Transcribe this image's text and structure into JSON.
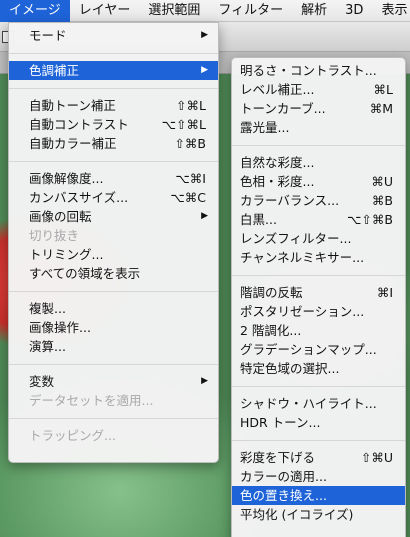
{
  "menubar": {
    "items": [
      "イメージ",
      "レイヤー",
      "選択範囲",
      "フィルター",
      "解析",
      "3D",
      "表示"
    ],
    "active_index": 0
  },
  "image_menu": {
    "groups": [
      [
        {
          "label": "モード",
          "submenu": true
        }
      ],
      [
        {
          "label": "色調補正",
          "submenu": true,
          "highlighted": true
        }
      ],
      [
        {
          "label": "自動トーン補正",
          "shortcut": "⇧⌘L"
        },
        {
          "label": "自動コントラスト",
          "shortcut": "⌥⇧⌘L"
        },
        {
          "label": "自動カラー補正",
          "shortcut": "⇧⌘B"
        }
      ],
      [
        {
          "label": "画像解像度...",
          "shortcut": "⌥⌘I"
        },
        {
          "label": "カンバスサイズ...",
          "shortcut": "⌥⌘C"
        },
        {
          "label": "画像の回転",
          "submenu": true
        },
        {
          "label": "切り抜き",
          "disabled": true
        },
        {
          "label": "トリミング..."
        },
        {
          "label": "すべての領域を表示"
        }
      ],
      [
        {
          "label": "複製..."
        },
        {
          "label": "画像操作..."
        },
        {
          "label": "演算..."
        }
      ],
      [
        {
          "label": "変数",
          "submenu": true
        },
        {
          "label": "データセットを適用...",
          "disabled": true
        }
      ],
      [
        {
          "label": "トラッピング...",
          "disabled": true
        }
      ]
    ]
  },
  "adjustments_menu": {
    "groups": [
      [
        {
          "label": "明るさ・コントラスト..."
        },
        {
          "label": "レベル補正...",
          "shortcut": "⌘L"
        },
        {
          "label": "トーンカーブ...",
          "shortcut": "⌘M"
        },
        {
          "label": "露光量..."
        }
      ],
      [
        {
          "label": "自然な彩度..."
        },
        {
          "label": "色相・彩度...",
          "shortcut": "⌘U"
        },
        {
          "label": "カラーバランス...",
          "shortcut": "⌘B"
        },
        {
          "label": "白黒...",
          "shortcut": "⌥⇧⌘B"
        },
        {
          "label": "レンズフィルター..."
        },
        {
          "label": "チャンネルミキサー..."
        }
      ],
      [
        {
          "label": "階調の反転",
          "shortcut": "⌘I"
        },
        {
          "label": "ポスタリゼーション..."
        },
        {
          "label": "2 階調化..."
        },
        {
          "label": "グラデーションマップ..."
        },
        {
          "label": "特定色域の選択..."
        }
      ],
      [
        {
          "label": "シャドウ・ハイライト..."
        },
        {
          "label": "HDR トーン..."
        }
      ],
      [
        {
          "label": "彩度を下げる",
          "shortcut": "⇧⌘U"
        },
        {
          "label": "カラーの適用..."
        },
        {
          "label": "色の置き換え...",
          "highlighted": true
        },
        {
          "label": "平均化 (イコライズ)"
        }
      ]
    ]
  },
  "colors": {
    "highlight": "#1e64d8",
    "menu_bg": "#f3f3f3",
    "disabled_text": "#a9a9a9"
  },
  "icons": {
    "submenu_arrow": "▶"
  }
}
